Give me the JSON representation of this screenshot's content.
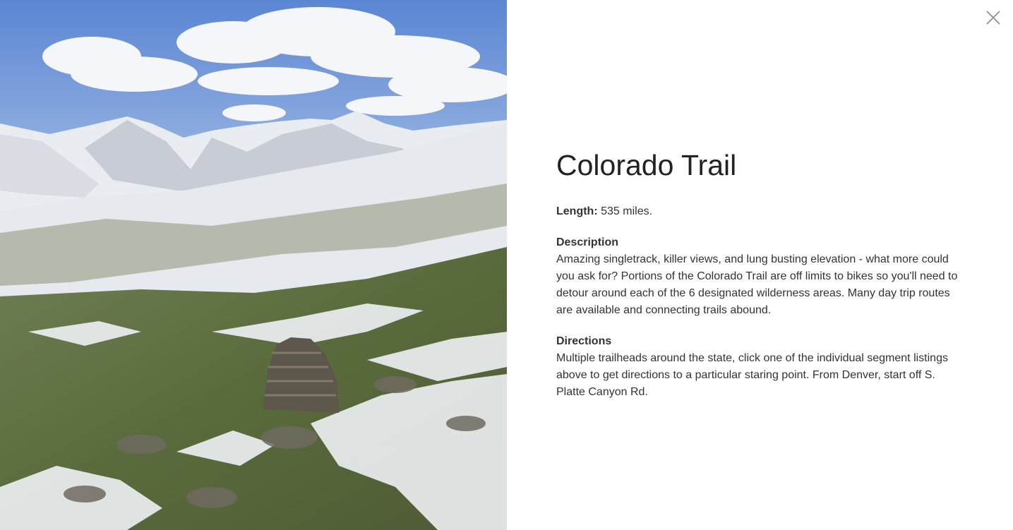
{
  "photo": {
    "alt": "Colorado Trail",
    "icon": "landscape-photo"
  },
  "close": {
    "icon": "close-icon",
    "label": "Close"
  },
  "trail": {
    "title": "Colorado Trail",
    "length_label": "Length:",
    "length_value": "535 miles.",
    "description_heading": "Description",
    "description_text": "Amazing singletrack, killer views, and lung busting elevation - what more could you ask for? Portions of the Colorado Trail are off limits to bikes so you'll need to detour around each of the 6 designated wilderness areas. Many day trip routes are available and connecting trails abound.",
    "directions_heading": "Directions",
    "directions_text": "Multiple trailheads around the state, click one of the individual segment listings above to get directions to a particular staring point. From Denver, start off S. Platte Canyon Rd."
  },
  "colors": {
    "text": "#333333",
    "title": "#222222",
    "close": "#8a8a8a",
    "background": "#ffffff"
  }
}
